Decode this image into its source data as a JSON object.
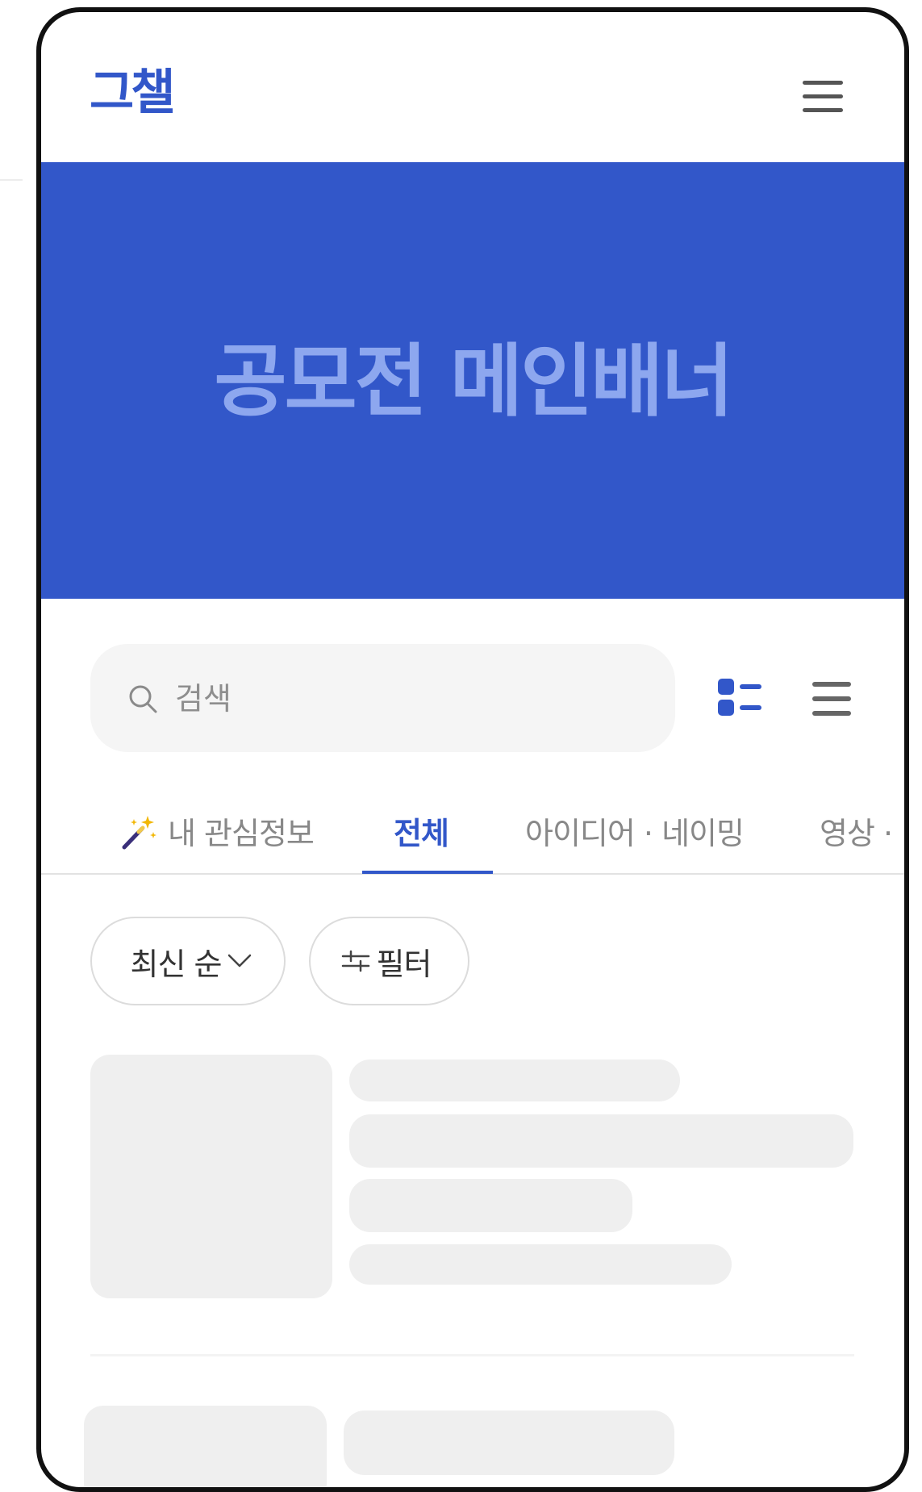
{
  "app": {
    "logo": "그챌"
  },
  "header": {
    "menu_icon": "hamburger-menu-icon"
  },
  "banner": {
    "title": "공모전 메인배너",
    "bg_color": "#3257c9",
    "text_color": "#8da7ef"
  },
  "search": {
    "placeholder": "검색",
    "icon": "search-icon"
  },
  "view_toggle": {
    "card_view_icon": "card-view-icon",
    "list_view_icon": "list-view-icon",
    "active": "card"
  },
  "tabs": [
    {
      "label": "내 관심정보",
      "icon": "magic-wand-icon",
      "active": false
    },
    {
      "label": "전체",
      "active": true
    },
    {
      "label": "아이디어 · 네이밍",
      "active": false
    },
    {
      "label": "영상 · ",
      "active": false
    }
  ],
  "sort": {
    "label": "최신 순",
    "icon": "chevron-down-icon"
  },
  "filter": {
    "label": "필터",
    "icon": "sliders-icon"
  },
  "colors": {
    "accent": "#3257c9",
    "skeleton": "#efefef",
    "muted_text": "#888888"
  }
}
